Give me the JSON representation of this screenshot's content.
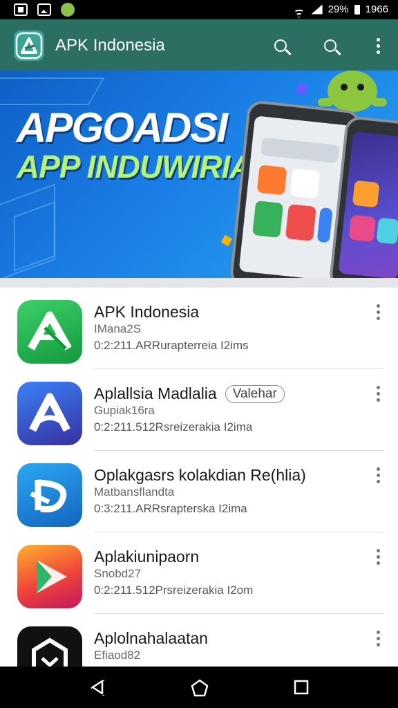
{
  "status_bar": {
    "battery_text": "29%",
    "time": "1966",
    "icons": [
      "document-icon",
      "gallery-icon",
      "android-icon",
      "wifi-icon",
      "signal-icon",
      "battery-icon"
    ]
  },
  "app_bar": {
    "title": "APK Indonesia",
    "icons": [
      "app-logo-icon",
      "search-icon",
      "search-icon",
      "more-vert-icon"
    ]
  },
  "banner": {
    "line1": "APGOADSI",
    "line2": "APP INDUWIRIA"
  },
  "apps": [
    {
      "name": "APK Indonesia",
      "subtitle": "IMana2S",
      "meta": "0:2:211.ARRurapterreia I2ims",
      "badge": "",
      "icon": "green-triangle-logo-icon",
      "color": "#1fb24e"
    },
    {
      "name": "Aplallsia Madlalia",
      "subtitle": "Gupiak16ra",
      "meta": "0:2:211.512Rsreizerakia I2ima",
      "badge": "Valehar",
      "icon": "blue-a-logo-icon",
      "color": "#2563eb"
    },
    {
      "name": "Oplakgasrs kolakdian Re(hlia)",
      "subtitle": "Matbansflandta",
      "meta": "0:3:211.ARRsrapterska I2ima",
      "badge": "",
      "icon": "cyan-swirl-logo-icon",
      "color": "#1e8fe0"
    },
    {
      "name": "Aplakiunipaorn",
      "subtitle": "Snobd27",
      "meta": "0:2:211.512Prsreizerakia I2om",
      "badge": "",
      "icon": "gradient-play-logo-icon",
      "color": "#f57c1f"
    },
    {
      "name": "Aplolnahalaatan",
      "subtitle": "Efiaod82",
      "meta": "",
      "badge": "",
      "icon": "black-cube-logo-icon",
      "color": "#111111"
    }
  ],
  "nav_bar": {
    "icons": [
      "back-icon",
      "home-icon",
      "recents-icon"
    ]
  }
}
